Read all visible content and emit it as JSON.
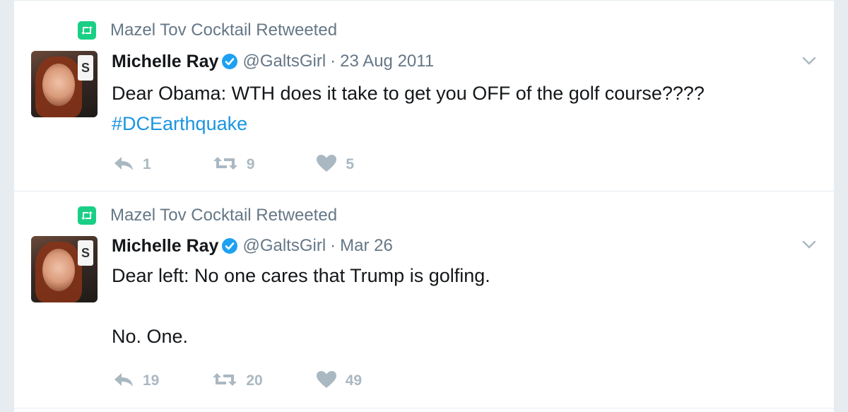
{
  "tweets": [
    {
      "retweeted_by": "Mazel Tov Cocktail Retweeted",
      "author_name": "Michelle Ray",
      "author_handle": "@GaltsGirl",
      "separator": "·",
      "date": "23 Aug 2011",
      "text_line_1": "Dear Obama: WTH does it take to get you OFF of the golf course????",
      "hashtag": "#DCEarthquake",
      "reply_count": "1",
      "retweet_count": "9",
      "like_count": "5"
    },
    {
      "retweeted_by": "Mazel Tov Cocktail Retweeted",
      "author_name": "Michelle Ray",
      "author_handle": "@GaltsGirl",
      "separator": "·",
      "date": "Mar 26",
      "text_line_1": "Dear left: No one cares that Trump is golfing.",
      "text_line_2": "No. One.",
      "reply_count": "19",
      "retweet_count": "20",
      "like_count": "49"
    }
  ],
  "avatar_badge": "S",
  "colors": {
    "retweet_green": "#19cf86",
    "link_blue": "#1b95e0",
    "verified_blue": "#1da1f2",
    "muted_gray": "#657786",
    "icon_gray": "#aab8c2"
  }
}
